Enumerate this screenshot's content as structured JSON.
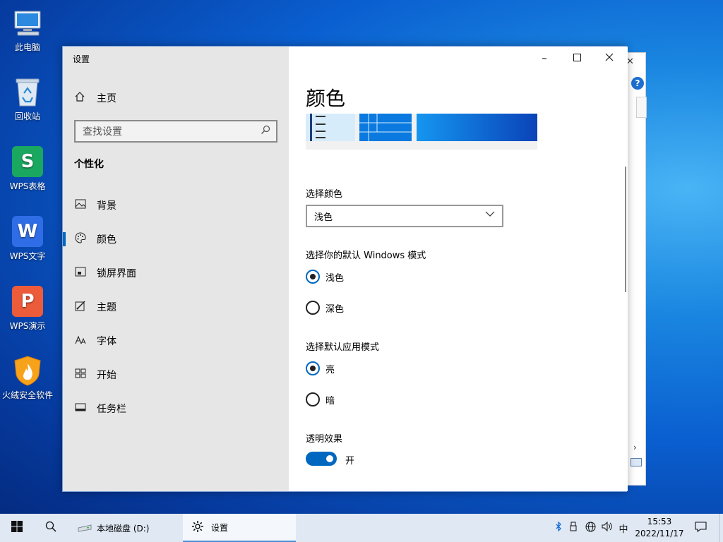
{
  "desktop": {
    "icons": [
      {
        "label": "此电脑"
      },
      {
        "label": "回收站"
      },
      {
        "label": "WPS表格",
        "glyph": "S",
        "color": "#1aa760"
      },
      {
        "label": "WPS文字",
        "glyph": "W",
        "color": "#2f6de6"
      },
      {
        "label": "WPS演示",
        "glyph": "P",
        "color": "#ec5b3a"
      },
      {
        "label": "火绒安全软件"
      }
    ]
  },
  "settings": {
    "window_title": "设置",
    "home_label": "主页",
    "search_placeholder": "查找设置",
    "section_title": "个性化",
    "nav": [
      {
        "label": "背景",
        "icon": "image-icon"
      },
      {
        "label": "颜色",
        "icon": "palette-icon",
        "active": true
      },
      {
        "label": "锁屏界面",
        "icon": "lockscreen-icon"
      },
      {
        "label": "主题",
        "icon": "theme-icon"
      },
      {
        "label": "字体",
        "icon": "font-icon"
      },
      {
        "label": "开始",
        "icon": "start-icon"
      },
      {
        "label": "任务栏",
        "icon": "taskbar-icon"
      }
    ],
    "page_title": "颜色",
    "choose_color_label": "选择颜色",
    "choose_color_value": "浅色",
    "windows_mode_label": "选择你的默认 Windows 模式",
    "windows_mode_options": [
      "浅色",
      "深色"
    ],
    "windows_mode_selected": "浅色",
    "app_mode_label": "选择默认应用模式",
    "app_mode_options": [
      "亮",
      "暗"
    ],
    "app_mode_selected": "亮",
    "transparency_label": "透明效果",
    "transparency_state": "开",
    "accent": "#0067c0"
  },
  "taskbar": {
    "apps": [
      {
        "label": "本地磁盘 (D:)"
      },
      {
        "label": "设置"
      }
    ],
    "ime": "中",
    "time": "15:53",
    "date": "2022/11/17"
  }
}
